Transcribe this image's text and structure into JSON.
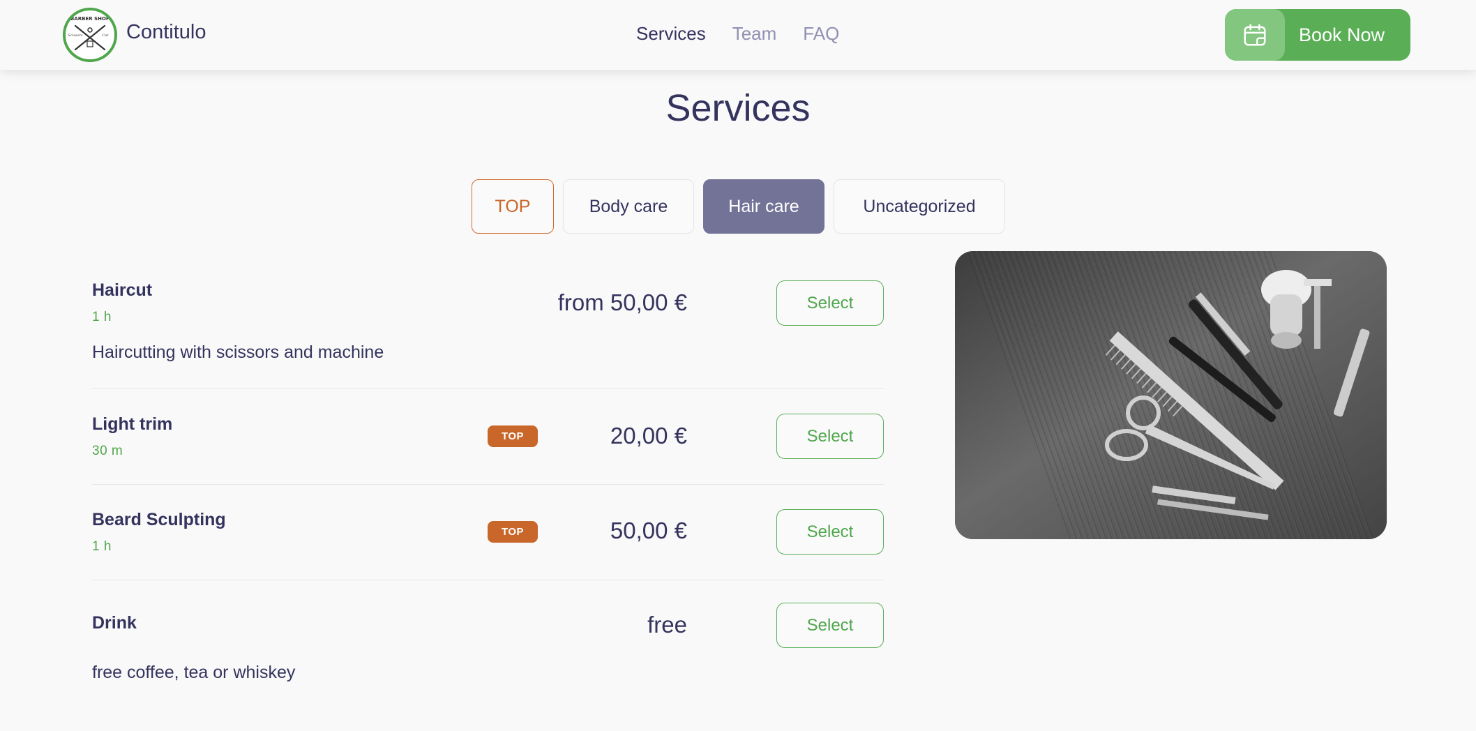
{
  "header": {
    "brand": "Contitulo",
    "nav": [
      {
        "label": "Services",
        "active": true
      },
      {
        "label": "Team",
        "active": false
      },
      {
        "label": "FAQ",
        "active": false
      }
    ],
    "book_button": {
      "label": "Book Now",
      "icon": "calendar-icon"
    },
    "logo": {
      "text_top": "BARBER SHOP",
      "text_left": "Scissors",
      "text_right": "Cut"
    }
  },
  "page": {
    "title": "Services"
  },
  "tabs": [
    {
      "label": "TOP",
      "state": "outlined"
    },
    {
      "label": "Body care",
      "state": "default"
    },
    {
      "label": "Hair care",
      "state": "selected"
    },
    {
      "label": "Uncategorized",
      "state": "default"
    }
  ],
  "services": [
    {
      "name": "Haircut",
      "duration": "1 h",
      "description": "Haircutting with scissors and machine",
      "price": "from 50,00 €",
      "badge": "",
      "select_label": "Select"
    },
    {
      "name": "Light trim",
      "duration": "30 m",
      "description": "",
      "price": "20,00 €",
      "badge": "TOP",
      "select_label": "Select"
    },
    {
      "name": "Beard Sculpting",
      "duration": "1 h",
      "description": "",
      "price": "50,00 €",
      "badge": "TOP",
      "select_label": "Select"
    },
    {
      "name": "Drink",
      "duration": "",
      "description": "free coffee, tea or whiskey",
      "price": "free",
      "badge": "",
      "select_label": "Select"
    }
  ],
  "colors": {
    "primary_text": "#34335e",
    "accent_green": "#5aaf56",
    "accent_orange": "#c9672b",
    "tab_selected": "#737397",
    "nav_muted": "#8f8fb3"
  }
}
